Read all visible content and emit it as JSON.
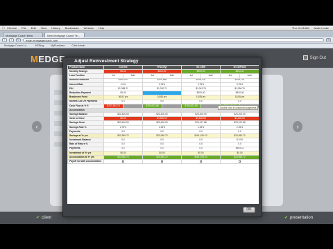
{
  "menubar": {
    "items": [
      "Chrome",
      "File",
      "Edit",
      "View",
      "History",
      "Bookmarks",
      "Window",
      "Help"
    ],
    "clock": "Thu 10:45 AM",
    "user": "Justin Locke"
  },
  "browser": {
    "tabs": [
      "Mortgage Coach Beta",
      "New Mortgage Coach Te..."
    ],
    "address": "edge.mortgagecoach.com",
    "bookmarks": [
      "Mortgage Coach Lo...",
      "MCBlog",
      "MyPurchase",
      "Citrix Admin"
    ]
  },
  "app": {
    "logo_prefix": "M",
    "logo_text": "EDGE",
    "signout": "Sign Out",
    "nav_left": "client",
    "nav_right": "presentation"
  },
  "modal": {
    "title": "Adjust Reinvestment Strategy",
    "ok": "OK",
    "tooltip": "Double click to customize payments",
    "columns": [
      "Current",
      "FHA 30yr",
      "5/1 ARM",
      "5/1 30Fixed"
    ],
    "header_tags": [
      "$0.00",
      "$300.00",
      "$300.00",
      "$300.00"
    ],
    "rows": [
      {
        "label": "Product Name",
        "cells": [
          "Current",
          "FHA 30yr",
          "5/1 ARM",
          "5/1 30Fixed"
        ],
        "kind": "hdr"
      },
      {
        "label": "Monthly Savings",
        "cells": [
          "$0.00",
          "$300.00",
          "$300.00",
          "$300.00"
        ],
        "kind": "tags"
      },
      {
        "label": "Loan Position",
        "cells": [
          "1st",
          "Add",
          "1st",
          "Add",
          "1st",
          "Add",
          "1st",
          "Add"
        ],
        "kind": "sub"
      },
      {
        "label": "Amount Financed",
        "cells": [
          "$245,210",
          "$229,884",
          "$228,131",
          "$228,131"
        ]
      },
      {
        "label": "Interest Rate",
        "cells": [
          "4.5%",
          "3.75%",
          "3.75%",
          "3.75%"
        ]
      },
      {
        "label": "P&I",
        "cells": [
          "$1,388.21",
          "$1,020.71",
          "$1,043.76",
          "$1,056.76"
        ]
      },
      {
        "label": "Reduction Payment",
        "cells": [
          "$0.00",
          "",
          "$300.00",
          "$300.00"
        ],
        "kind": "reduction"
      },
      {
        "label": "Breakeven Point",
        "cells": [
          "36.81 yrs",
          "18.85 yrs",
          "18.85 yrs",
          "18.85 yrs"
        ],
        "kind": "yellow"
      },
      {
        "label": "Months Cut Off Payments",
        "cells": [
          "0.0",
          "0.0",
          "0.0",
          "0.0"
        ]
      },
      {
        "label": "Cash Flow at Yr 5",
        "cells": [
          "$707,333.75",
          "$753,003.88",
          "$753,003.88",
          "$753,003.88"
        ],
        "kind": "cashflow"
      },
      {
        "label": "Accumulation",
        "cells": [],
        "kind": "sect"
      },
      {
        "label": "Savings Balance",
        "cells": [
          "$23,400.00",
          "$23,400.00",
          "$23,400.00",
          "$23,400.00"
        ]
      },
      {
        "label": "Cash to Close",
        "cells": [
          "$0.00",
          "$3,500.00",
          "$3,500.00",
          "$3,500.00"
        ],
        "kind": "cashclose"
      },
      {
        "label": "Savings Grow",
        "cells": [
          "$23,400.00",
          "$23,400.00",
          "$23,417.88",
          "$23,317.88"
        ]
      },
      {
        "label": "Savings Rate %",
        "cells": [
          "2.75%",
          "2.25%",
          "2.25%",
          "2.25%"
        ]
      },
      {
        "label": "Payments",
        "cells": [
          "0.0",
          "0.0",
          "0.0",
          "0.0"
        ]
      },
      {
        "label": "Savings at Yr yrs",
        "cells": [
          "$23,950.72",
          "$23,950.72",
          "$161,190.23",
          "$23,950.72"
        ],
        "kind": "yellow"
      },
      {
        "label": "Investment Balance",
        "cells": [
          "0.0",
          "0.0",
          "0.0",
          "$ 0.00"
        ]
      },
      {
        "label": "Rate of Return %",
        "cells": [
          "0.0",
          "0.0",
          "0.0",
          "0.0"
        ]
      },
      {
        "label": "Payments",
        "cells": [
          "0.0",
          "0.0",
          "0.0",
          "$405.11"
        ]
      },
      {
        "label": "Investment at Yr yrs",
        "cells": [
          "$0.00",
          "$0.00",
          "$0.00",
          "$0.00"
        ],
        "kind": "yellow"
      },
      {
        "label": "Accumulation at Yr yrs",
        "cells": [
          "$23,950.72",
          "$23,950.72",
          "$161,190.23",
          "$23,950.72"
        ],
        "kind": "green"
      },
      {
        "label": "Payoff 1st with Accumulation",
        "cells": [
          "",
          "",
          "",
          ""
        ],
        "kind": "checks"
      }
    ]
  },
  "colors": {
    "accent_red": "#e23a1f",
    "accent_green": "#6aaa2b",
    "accent_blue": "#2aa7e8",
    "header_grey": "#555555"
  }
}
